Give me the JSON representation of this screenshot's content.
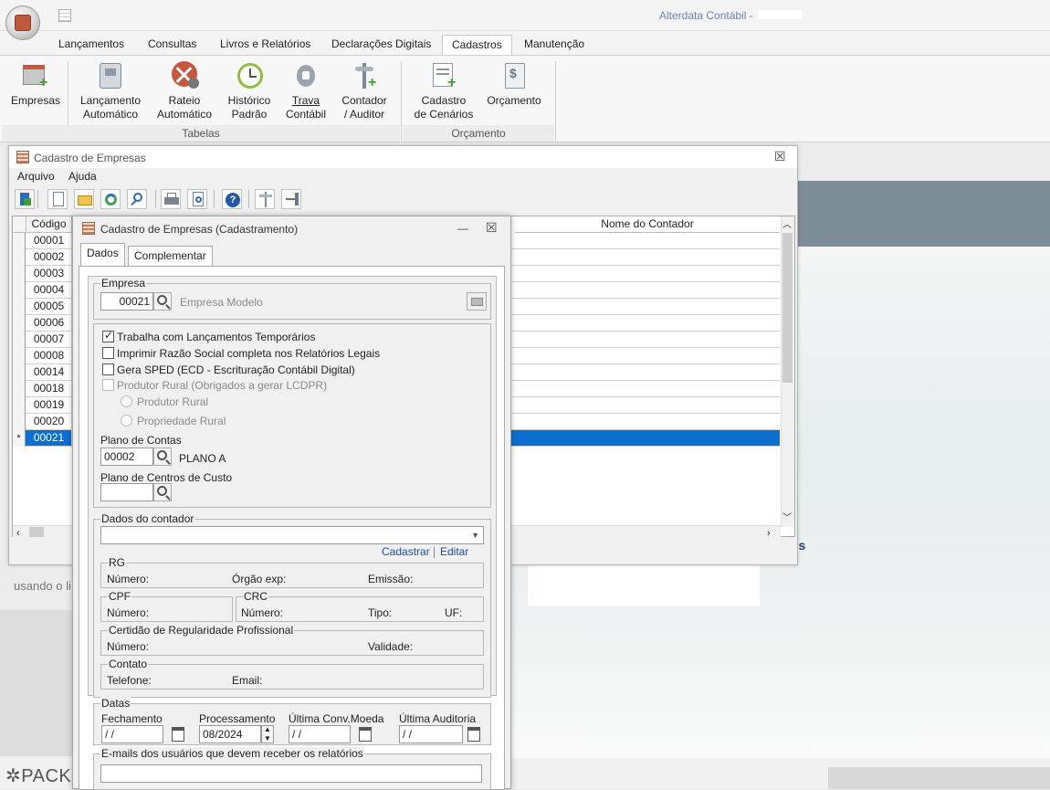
{
  "app": {
    "title": "Alterdata Contábil -"
  },
  "ribbon": {
    "tabs": [
      "Lançamentos",
      "Consultas",
      "Livros e Relatórios",
      "Declarações Digitais",
      "Cadastros",
      "Manutenção"
    ],
    "active_tab": "Cadastros",
    "buttons": {
      "empresas": [
        "Empresas"
      ],
      "lancamento": [
        "Lançamento",
        "Automático"
      ],
      "rateio": [
        "Rateio",
        "Automático"
      ],
      "historico": [
        "Histórico",
        "Padrão"
      ],
      "trava": [
        "Trava",
        "Contábil"
      ],
      "contador": [
        "Contador",
        "/ Auditor"
      ],
      "cenarios": [
        "Cadastro",
        "de Cenários"
      ],
      "orcamento": [
        "Orçamento"
      ]
    },
    "groups": {
      "tabelas": "Tabelas",
      "orcamento": "Orçamento"
    }
  },
  "background": {
    "usando": "usando o li",
    "os_text": "os",
    "pack": "PACK"
  },
  "win1": {
    "title": "Cadastro de Empresas",
    "menu": [
      "Arquivo",
      "Ajuda"
    ],
    "grid": {
      "headers": {
        "codigo": "Código",
        "contador": "Nome do Contador"
      },
      "rows": [
        "00001",
        "00002",
        "00003",
        "00004",
        "00005",
        "00006",
        "00007",
        "00008",
        "00014",
        "00018",
        "00019",
        "00020",
        "00021"
      ],
      "selected_indicator": "*"
    }
  },
  "win2": {
    "title": "Cadastro de Empresas (Cadastramento)",
    "tabs": [
      "Dados",
      "Complementar"
    ],
    "empresa": {
      "legend": "Empresa",
      "code": "00021",
      "name": "Empresa Modelo"
    },
    "options": {
      "temporarios": "Trabalha com Lançamentos Temporários",
      "razao": "Imprimir Razão Social completa nos Relatórios Legais",
      "sped": "Gera SPED (ECD - Escrituração Contábil Digital)",
      "produtor": "Produtor Rural  (Obrigados a gerar LCDPR)",
      "radio1": "Produtor Rural",
      "radio2": "Propriedade Rural"
    },
    "plano_contas": {
      "label": "Plano de Contas",
      "code": "00002",
      "name": "PLANO A"
    },
    "plano_custo": {
      "label": "Plano de Centros de Custo",
      "code": ""
    },
    "contador": {
      "legend": "Dados do contador",
      "cadastrar": "Cadastrar",
      "editar": "Editar",
      "rg": {
        "legend": "RG",
        "numero": "Número:",
        "orgao": "Órgão exp:",
        "emissao": "Emissão:"
      },
      "cpf": {
        "legend": "CPF",
        "numero": "Número:"
      },
      "crc": {
        "legend": "CRC",
        "numero": "Número:",
        "tipo": "Tipo:",
        "uf": "UF:"
      },
      "certidao": {
        "legend": "Certidão de Regularidade Profissional",
        "numero": "Número:",
        "validade": "Validade:"
      },
      "contato": {
        "legend": "Contato",
        "telefone": "Telefone:",
        "email": "Email:"
      }
    },
    "datas": {
      "legend": "Datas",
      "fechamento": {
        "label": "Fechamento",
        "value": " / /"
      },
      "processamento": {
        "label": "Processamento",
        "value": "08/2024"
      },
      "conv_moeda": {
        "label": "Última Conv.Moeda",
        "value": " / /"
      },
      "auditoria": {
        "label": "Última Auditoria",
        "value": " / /"
      }
    },
    "emails": {
      "legend": "E-mails dos usuários que devem receber os relatórios"
    }
  }
}
